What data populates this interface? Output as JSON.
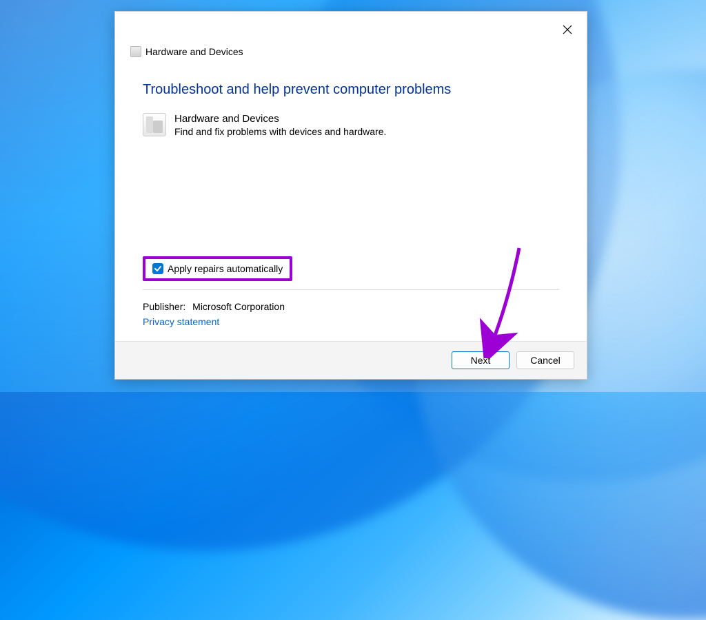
{
  "header": {
    "title": "Hardware and Devices"
  },
  "main": {
    "heading": "Troubleshoot and help prevent computer problems",
    "item": {
      "title": "Hardware and Devices",
      "description": "Find and fix problems with devices and hardware."
    },
    "checkbox": {
      "label": "Apply repairs automatically",
      "checked": true
    },
    "publisher": {
      "label": "Publisher:",
      "value": "Microsoft Corporation"
    },
    "privacy_link": "Privacy statement"
  },
  "footer": {
    "next_label": "Next",
    "cancel_label": "Cancel"
  }
}
